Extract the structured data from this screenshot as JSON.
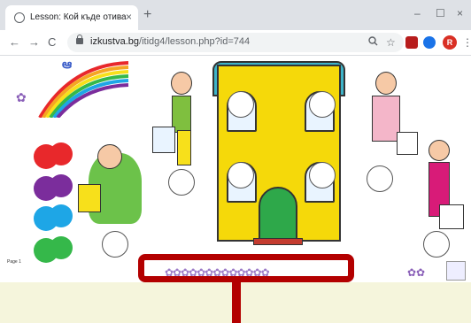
{
  "browser": {
    "tab_title": "Lesson: Кой къде отива",
    "close_glyph": "×",
    "new_tab_glyph": "+",
    "window_controls": [
      "–",
      "☐",
      "×"
    ],
    "nav": {
      "back": "←",
      "forward": "→",
      "reload": "C"
    },
    "url_domain": "izkustva.bg",
    "url_path": "/itidg4/lesson.php?id=744",
    "avatar_letter": "R",
    "menu_glyph": "⋮",
    "url_icons": [
      "zoom-icon",
      "star-icon"
    ],
    "extension_colors": [
      "#b71c1c",
      "#1a73e8"
    ]
  },
  "page": {
    "page_label": "Page 1",
    "flower_row": "✿✿✿✿✿✿✿✿✿✿✿✿✿",
    "corner_flowers": "✿✿",
    "left_flower": "✿",
    "colors": {
      "red": "#e8282b",
      "purple": "#7b2d9c",
      "blue": "#1ea6e6",
      "green": "#35b84a",
      "callout": "#b30000"
    }
  }
}
